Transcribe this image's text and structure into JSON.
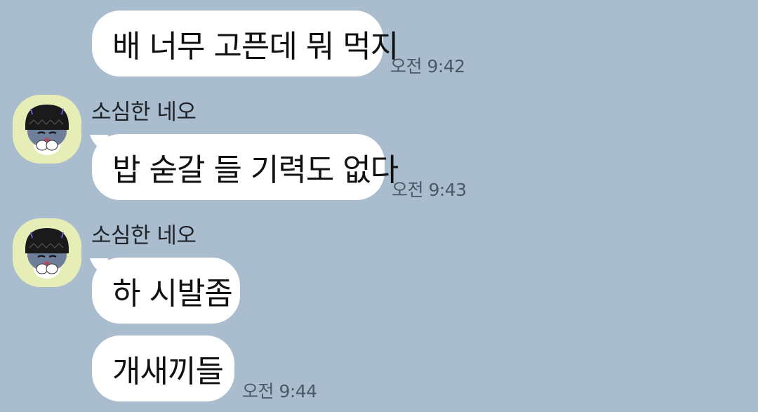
{
  "chat": {
    "messages": [
      {
        "text": "배 너무 고픈데 뭐 먹지",
        "time": "오전 9:42"
      },
      {
        "sender": "소심한 네오",
        "text": "밥 숟갈 들 기력도 없다",
        "time": "오전 9:43"
      },
      {
        "sender": "소심한 네오",
        "text": "하 시발좀"
      },
      {
        "text": "개새끼들",
        "time": "오전 9:44"
      }
    ]
  },
  "colors": {
    "background": "#a9bdcf",
    "bubble": "#ffffff",
    "avatar_bg": "#e6edb6"
  },
  "icons": {
    "avatar": "neo-character-avatar-icon"
  }
}
